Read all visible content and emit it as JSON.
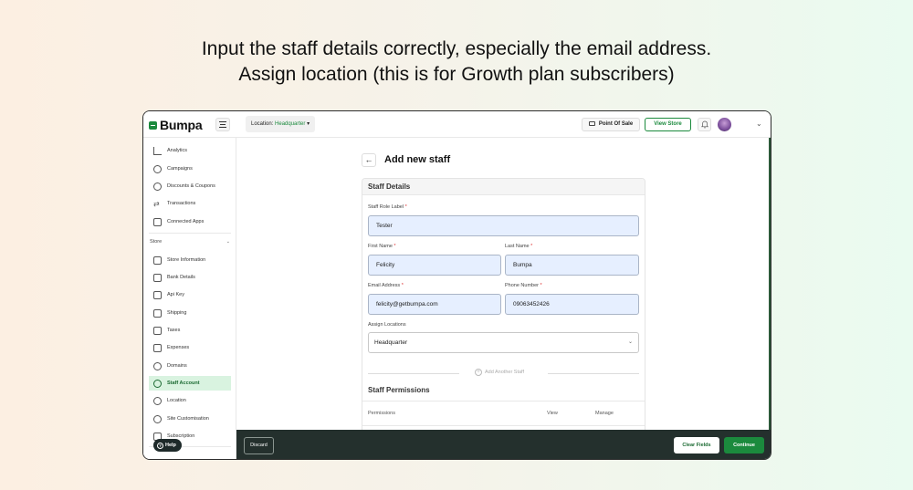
{
  "headline": {
    "line1": "Input the staff details correctly, especially the email address.",
    "line2": "Assign location (this is for Growth plan subscribers)"
  },
  "topbar": {
    "logo": "Bumpa",
    "location_label": "Location:",
    "location_value": "Headquarter",
    "location_chevron": "▾",
    "pos_label": "Point Of Sale",
    "view_store_label": "View Store",
    "chevron": "⌄"
  },
  "sidebar": {
    "items": [
      {
        "label": "Analytics",
        "icon": "chart-icon"
      },
      {
        "label": "Campaigns",
        "icon": "megaphone-icon"
      },
      {
        "label": "Discounts & Coupons",
        "icon": "discount-icon"
      },
      {
        "label": "Transactions",
        "icon": "transfer-icon"
      },
      {
        "label": "Connected Apps",
        "icon": "apps-icon"
      }
    ],
    "section_label": "Store",
    "section_chevron": "⌄",
    "store_items": [
      {
        "label": "Store Information",
        "icon": "store-icon"
      },
      {
        "label": "Bank Details",
        "icon": "bank-icon"
      },
      {
        "label": "Api Key",
        "icon": "key-icon"
      },
      {
        "label": "Shipping",
        "icon": "truck-icon"
      },
      {
        "label": "Taxes",
        "icon": "tax-icon"
      },
      {
        "label": "Expenses",
        "icon": "receipt-icon"
      },
      {
        "label": "Domains",
        "icon": "globe-icon"
      },
      {
        "label": "Staff Account",
        "icon": "user-icon",
        "active": true
      },
      {
        "label": "Location",
        "icon": "location-icon"
      },
      {
        "label": "Site Customisation",
        "icon": "palette-icon"
      },
      {
        "label": "Subscription",
        "icon": "layers-icon"
      }
    ],
    "help_label": "Help"
  },
  "main": {
    "back_arrow": "←",
    "title": "Add new staff",
    "staff_details_title": "Staff Details",
    "role_label": "Staff Role Label",
    "role_value": "Tester",
    "first_name_label": "First Name",
    "first_name_value": "Felicity",
    "last_name_label": "Last Name",
    "last_name_value": "Bumpa",
    "email_label": "Email Address",
    "email_value": "felicity@getbumpa.com",
    "phone_label": "Phone Number",
    "phone_value": "09063452426",
    "locations_label": "Assign Locations",
    "locations_value": "Headquarter",
    "locations_chevron": "⌄",
    "required_mark": "*",
    "add_another_label": "Add Another Staff",
    "add_another_plus": "+",
    "permissions_title": "Staff Permissions",
    "perm_columns": [
      "Permissions",
      "View",
      "Manage"
    ]
  },
  "footer": {
    "discard_label": "Discard",
    "clear_label": "Clear Fields",
    "continue_label": "Continue"
  },
  "colors": {
    "brand_green": "#1b8a3d",
    "footer_bg": "#24302d",
    "active_bg": "#d9f3e0",
    "input_bg": "#e6efff"
  }
}
